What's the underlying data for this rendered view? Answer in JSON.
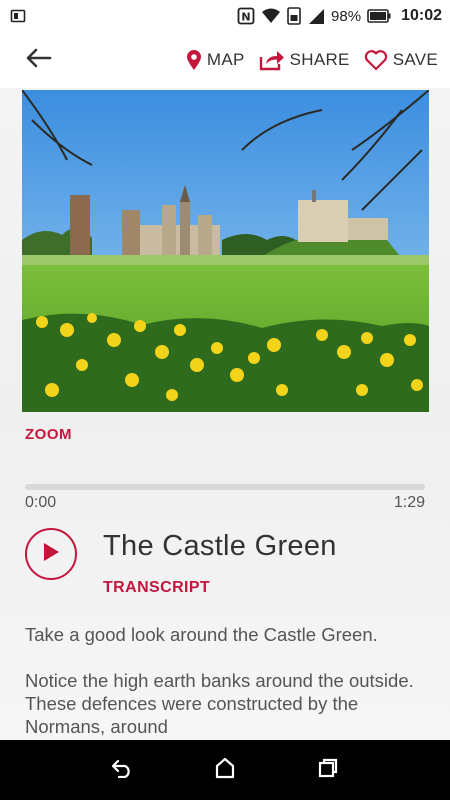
{
  "status_bar": {
    "battery_percent": "98%",
    "time": "10:02",
    "icons": [
      "sim-card-icon",
      "nfc-icon",
      "wifi-icon",
      "mobile-data-icon",
      "signal-icon",
      "battery-icon"
    ]
  },
  "header": {
    "back_icon": "arrow-left-icon",
    "actions": [
      {
        "label": "MAP",
        "icon": "map-pin-icon"
      },
      {
        "label": "SHARE",
        "icon": "share-icon"
      },
      {
        "label": "SAVE",
        "icon": "heart-icon"
      }
    ]
  },
  "media": {
    "image_description": "photo-castle-green",
    "zoom_label": "ZOOM"
  },
  "player": {
    "current_time": "0:00",
    "total_time": "1:29",
    "progress": 0,
    "title": "The Castle Green",
    "transcript_label": "TRANSCRIPT"
  },
  "body": {
    "paragraphs": [
      "Take a good look around the Castle Green.",
      "Notice the high earth banks around the outside. These defences were constructed by the Normans, around"
    ]
  },
  "colors": {
    "accent": "#c4163d",
    "text": "#333333",
    "muted_text": "#555555"
  },
  "nav_bar": {
    "buttons": [
      "back-nav-icon",
      "home-nav-icon",
      "recents-nav-icon"
    ]
  }
}
